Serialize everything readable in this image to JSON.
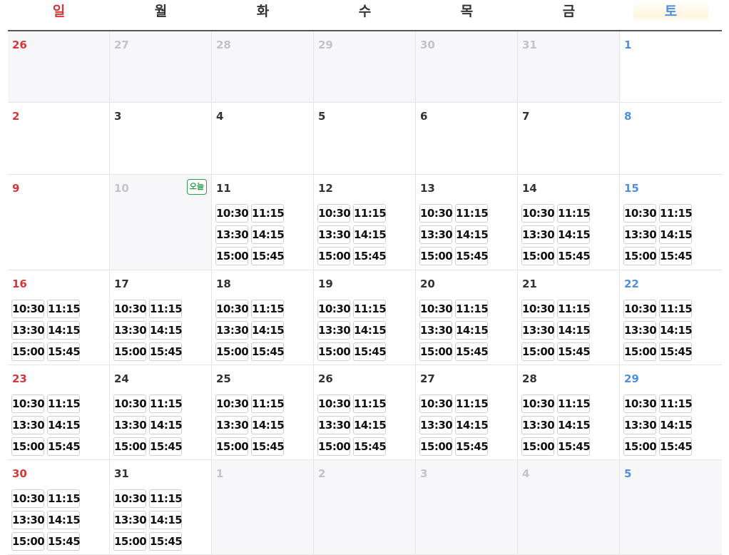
{
  "weekdays": [
    "일",
    "월",
    "화",
    "수",
    "목",
    "금",
    "토"
  ],
  "today_label": "오늘",
  "colors": {
    "sunday": "#d8363a",
    "saturday": "#4f8fdf",
    "today": "#2e9e4a",
    "other_month": "#c4c4c4"
  },
  "weeks": [
    [
      {
        "d": "26",
        "o": 1
      },
      {
        "d": "27",
        "o": 1
      },
      {
        "d": "28",
        "o": 1
      },
      {
        "d": "29",
        "o": 1
      },
      {
        "d": "30",
        "o": 1
      },
      {
        "d": "31",
        "o": 1
      },
      {
        "d": "1"
      }
    ],
    [
      {
        "d": "2"
      },
      {
        "d": "3"
      },
      {
        "d": "4"
      },
      {
        "d": "5"
      },
      {
        "d": "6"
      },
      {
        "d": "7"
      },
      {
        "d": "8"
      }
    ],
    [
      {
        "d": "9"
      },
      {
        "d": "10",
        "today": 1,
        "past": 1
      },
      {
        "d": "11",
        "s": 1
      },
      {
        "d": "12",
        "s": 1
      },
      {
        "d": "13",
        "s": 1
      },
      {
        "d": "14",
        "s": 1
      },
      {
        "d": "15",
        "s": 1
      }
    ],
    [
      {
        "d": "16",
        "s": 1
      },
      {
        "d": "17",
        "s": 1
      },
      {
        "d": "18",
        "s": 1
      },
      {
        "d": "19",
        "s": 1
      },
      {
        "d": "20",
        "s": 1
      },
      {
        "d": "21",
        "s": 1
      },
      {
        "d": "22",
        "s": 1
      }
    ],
    [
      {
        "d": "23",
        "s": 1
      },
      {
        "d": "24",
        "s": 1
      },
      {
        "d": "25",
        "s": 1
      },
      {
        "d": "26",
        "s": 1
      },
      {
        "d": "27",
        "s": 1
      },
      {
        "d": "28",
        "s": 1
      },
      {
        "d": "29",
        "s": 1
      }
    ],
    [
      {
        "d": "30",
        "s": 1
      },
      {
        "d": "31",
        "s": 1
      },
      {
        "d": "1",
        "o": 1
      },
      {
        "d": "2",
        "o": 1
      },
      {
        "d": "3",
        "o": 1
      },
      {
        "d": "4",
        "o": 1
      },
      {
        "d": "5",
        "o": 1
      }
    ]
  ],
  "time_slots": [
    "10:30",
    "11:15",
    "13:30",
    "14:15",
    "15:00",
    "15:45"
  ]
}
